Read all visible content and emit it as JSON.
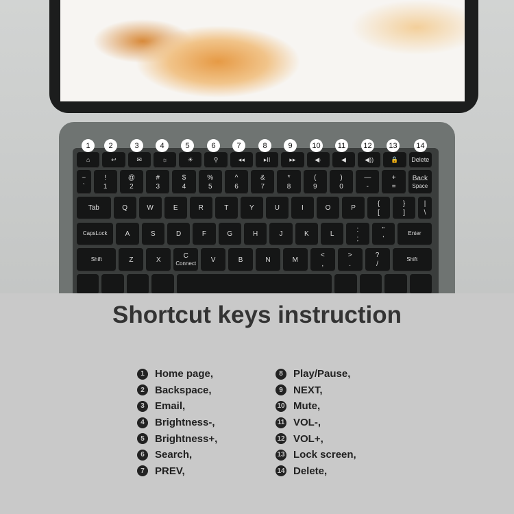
{
  "title": "Shortcut keys instruction",
  "callout_numbers": [
    "1",
    "2",
    "3",
    "4",
    "5",
    "6",
    "7",
    "8",
    "9",
    "10",
    "11",
    "12",
    "13",
    "14"
  ],
  "keyboard": {
    "fn_row": [
      {
        "icon": "home-icon",
        "t": "⌂"
      },
      {
        "icon": "back-icon",
        "t": "↩"
      },
      {
        "icon": "mail-icon",
        "t": "✉"
      },
      {
        "icon": "brightness-down-icon",
        "t": "☼"
      },
      {
        "icon": "brightness-up-icon",
        "t": "☀"
      },
      {
        "icon": "search-icon",
        "t": "⚲"
      },
      {
        "icon": "prev-icon",
        "t": "◂◂"
      },
      {
        "icon": "play-pause-icon",
        "t": "▸II"
      },
      {
        "icon": "next-icon",
        "t": "▸▸"
      },
      {
        "icon": "mute-icon",
        "t": "◀·"
      },
      {
        "icon": "vol-down-icon",
        "t": "◀"
      },
      {
        "icon": "vol-up-icon",
        "t": "◀))"
      },
      {
        "icon": "lock-icon",
        "t": "🔒"
      },
      {
        "t": "Delete"
      }
    ],
    "number_row": [
      [
        "~",
        "`"
      ],
      [
        "!",
        "1"
      ],
      [
        "@",
        "2"
      ],
      [
        "#",
        "3"
      ],
      [
        "$",
        "4"
      ],
      [
        "%",
        "5"
      ],
      [
        "^",
        "6"
      ],
      [
        "&",
        "7"
      ],
      [
        "*",
        "8"
      ],
      [
        "(",
        "9"
      ],
      [
        ")",
        "0"
      ],
      [
        "—",
        "-"
      ],
      [
        "+",
        "="
      ],
      [
        "Back",
        "Space"
      ]
    ],
    "tab_row": [
      [
        "",
        "Tab"
      ],
      [
        "",
        "Q"
      ],
      [
        "",
        "W"
      ],
      [
        "",
        "E"
      ],
      [
        "",
        "R"
      ],
      [
        "",
        "T"
      ],
      [
        "",
        "Y"
      ],
      [
        "",
        "U"
      ],
      [
        "",
        "I"
      ],
      [
        "",
        "O"
      ],
      [
        "",
        "P"
      ],
      [
        "{",
        "["
      ],
      [
        "}",
        "]"
      ],
      [
        "|",
        "\\"
      ]
    ],
    "caps_row": [
      [
        "",
        "CapsLock"
      ],
      [
        "",
        "A"
      ],
      [
        "",
        "S"
      ],
      [
        "",
        "D"
      ],
      [
        "",
        "F"
      ],
      [
        "",
        "G"
      ],
      [
        "",
        "H"
      ],
      [
        "",
        "J"
      ],
      [
        "",
        "K"
      ],
      [
        "",
        "L"
      ],
      [
        ":",
        ";"
      ],
      [
        "\"",
        "'"
      ],
      [
        "",
        "Enter"
      ]
    ],
    "shift_row": [
      [
        "",
        "Shift"
      ],
      [
        "",
        "Z"
      ],
      [
        "",
        "X"
      ],
      [
        "C",
        "Connect"
      ],
      [
        "",
        "V"
      ],
      [
        "",
        "B"
      ],
      [
        "",
        "N"
      ],
      [
        "",
        "M"
      ],
      [
        "<",
        ","
      ],
      [
        ">",
        "."
      ],
      [
        "?",
        "/"
      ],
      [
        "",
        "Shift"
      ]
    ]
  },
  "shortcuts_left": [
    {
      "n": "1",
      "label": "Home page,"
    },
    {
      "n": "2",
      "label": "Backspace,"
    },
    {
      "n": "3",
      "label": "Email,"
    },
    {
      "n": "4",
      "label": "Brightness-,"
    },
    {
      "n": "5",
      "label": "Brightness+,"
    },
    {
      "n": "6",
      "label": "Search,"
    },
    {
      "n": "7",
      "label": "PREV,"
    }
  ],
  "shortcuts_right": [
    {
      "n": "8",
      "label": "Play/Pause,"
    },
    {
      "n": "9",
      "label": "NEXT,"
    },
    {
      "n": "10",
      "label": "Mute,"
    },
    {
      "n": "11",
      "label": "VOL-,"
    },
    {
      "n": "12",
      "label": "VOL+,"
    },
    {
      "n": "13",
      "label": "Lock screen,"
    },
    {
      "n": "14",
      "label": "Delete,"
    }
  ]
}
